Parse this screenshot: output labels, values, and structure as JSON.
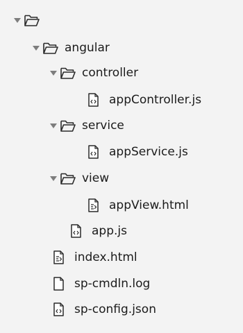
{
  "tree": {
    "root": {
      "label": ""
    },
    "angular": {
      "label": "angular"
    },
    "controller": {
      "label": "controller"
    },
    "app_controller": {
      "label": "appController.js"
    },
    "service": {
      "label": "service"
    },
    "app_service": {
      "label": "appService.js"
    },
    "view": {
      "label": "view"
    },
    "app_view": {
      "label": "appView.html"
    },
    "app_js": {
      "label": "app.js"
    },
    "index_html": {
      "label": "index.html"
    },
    "sp_cmdln": {
      "label": "sp-cmdln.log"
    },
    "sp_config": {
      "label": "sp-config.json"
    }
  },
  "icons": {
    "expanded": "chevron-down-expanded-icon",
    "folder": "folder-open-icon",
    "code_file": "code-file-icon",
    "html_file": "html-file-icon",
    "text_file": "blank-file-icon"
  },
  "colors": {
    "background": "#f3f3f3",
    "text": "#1b1b1b",
    "caret": "#7d7d7d",
    "icon": "#2a2a2a"
  }
}
